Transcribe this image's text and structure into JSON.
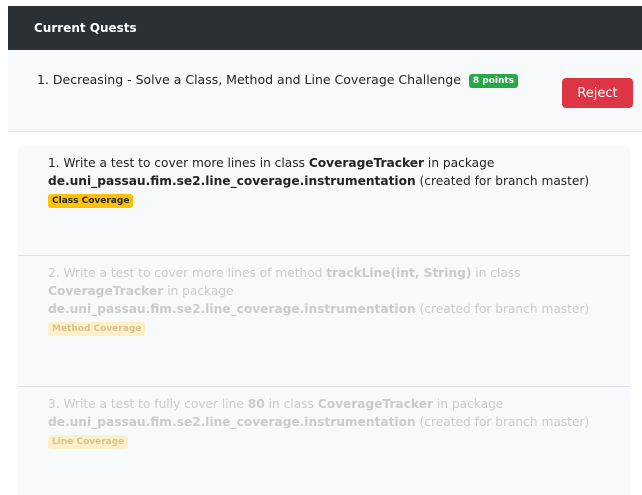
{
  "header": {
    "title": "Current Quests"
  },
  "quest": {
    "title": "1. Decreasing - Solve a Class, Method and Line Coverage Challenge",
    "points": "8 points",
    "reject_label": "Reject"
  },
  "tasks": [
    {
      "prefix": "1. Write a test to cover more lines in class ",
      "class_name": "CoverageTracker",
      "in_package": " in package",
      "package": "de.uni_passau.fim.se2.line_coverage.instrumentation",
      "branch": " (created for branch master)",
      "tag": "Class Coverage",
      "status": "active"
    },
    {
      "prefix": "2. Write a test to cover more lines of method ",
      "method_name": "trackLine(int, String)",
      "in_class": " in class",
      "class_name": "CoverageTracker",
      "in_package": " in package",
      "package": "de.uni_passau.fim.se2.line_coverage.instrumentation",
      "branch": " (created for branch master)",
      "tag": "Method Coverage",
      "status": "faded"
    },
    {
      "prefix": "3. Write a test to fully cover line ",
      "line": "80",
      "in_class": " in class ",
      "class_name": "CoverageTracker",
      "in_package": " in package",
      "package": "de.uni_passau.fim.se2.line_coverage.instrumentation",
      "branch": " (created for branch master)",
      "tag": "Line Coverage",
      "status": "faded"
    }
  ],
  "colors": {
    "header_bg": "#2b3035",
    "points_badge": "#28a745",
    "reject_button": "#dc3545",
    "tag_active": "#ffc107",
    "tag_faded": "#fdf0c8"
  }
}
